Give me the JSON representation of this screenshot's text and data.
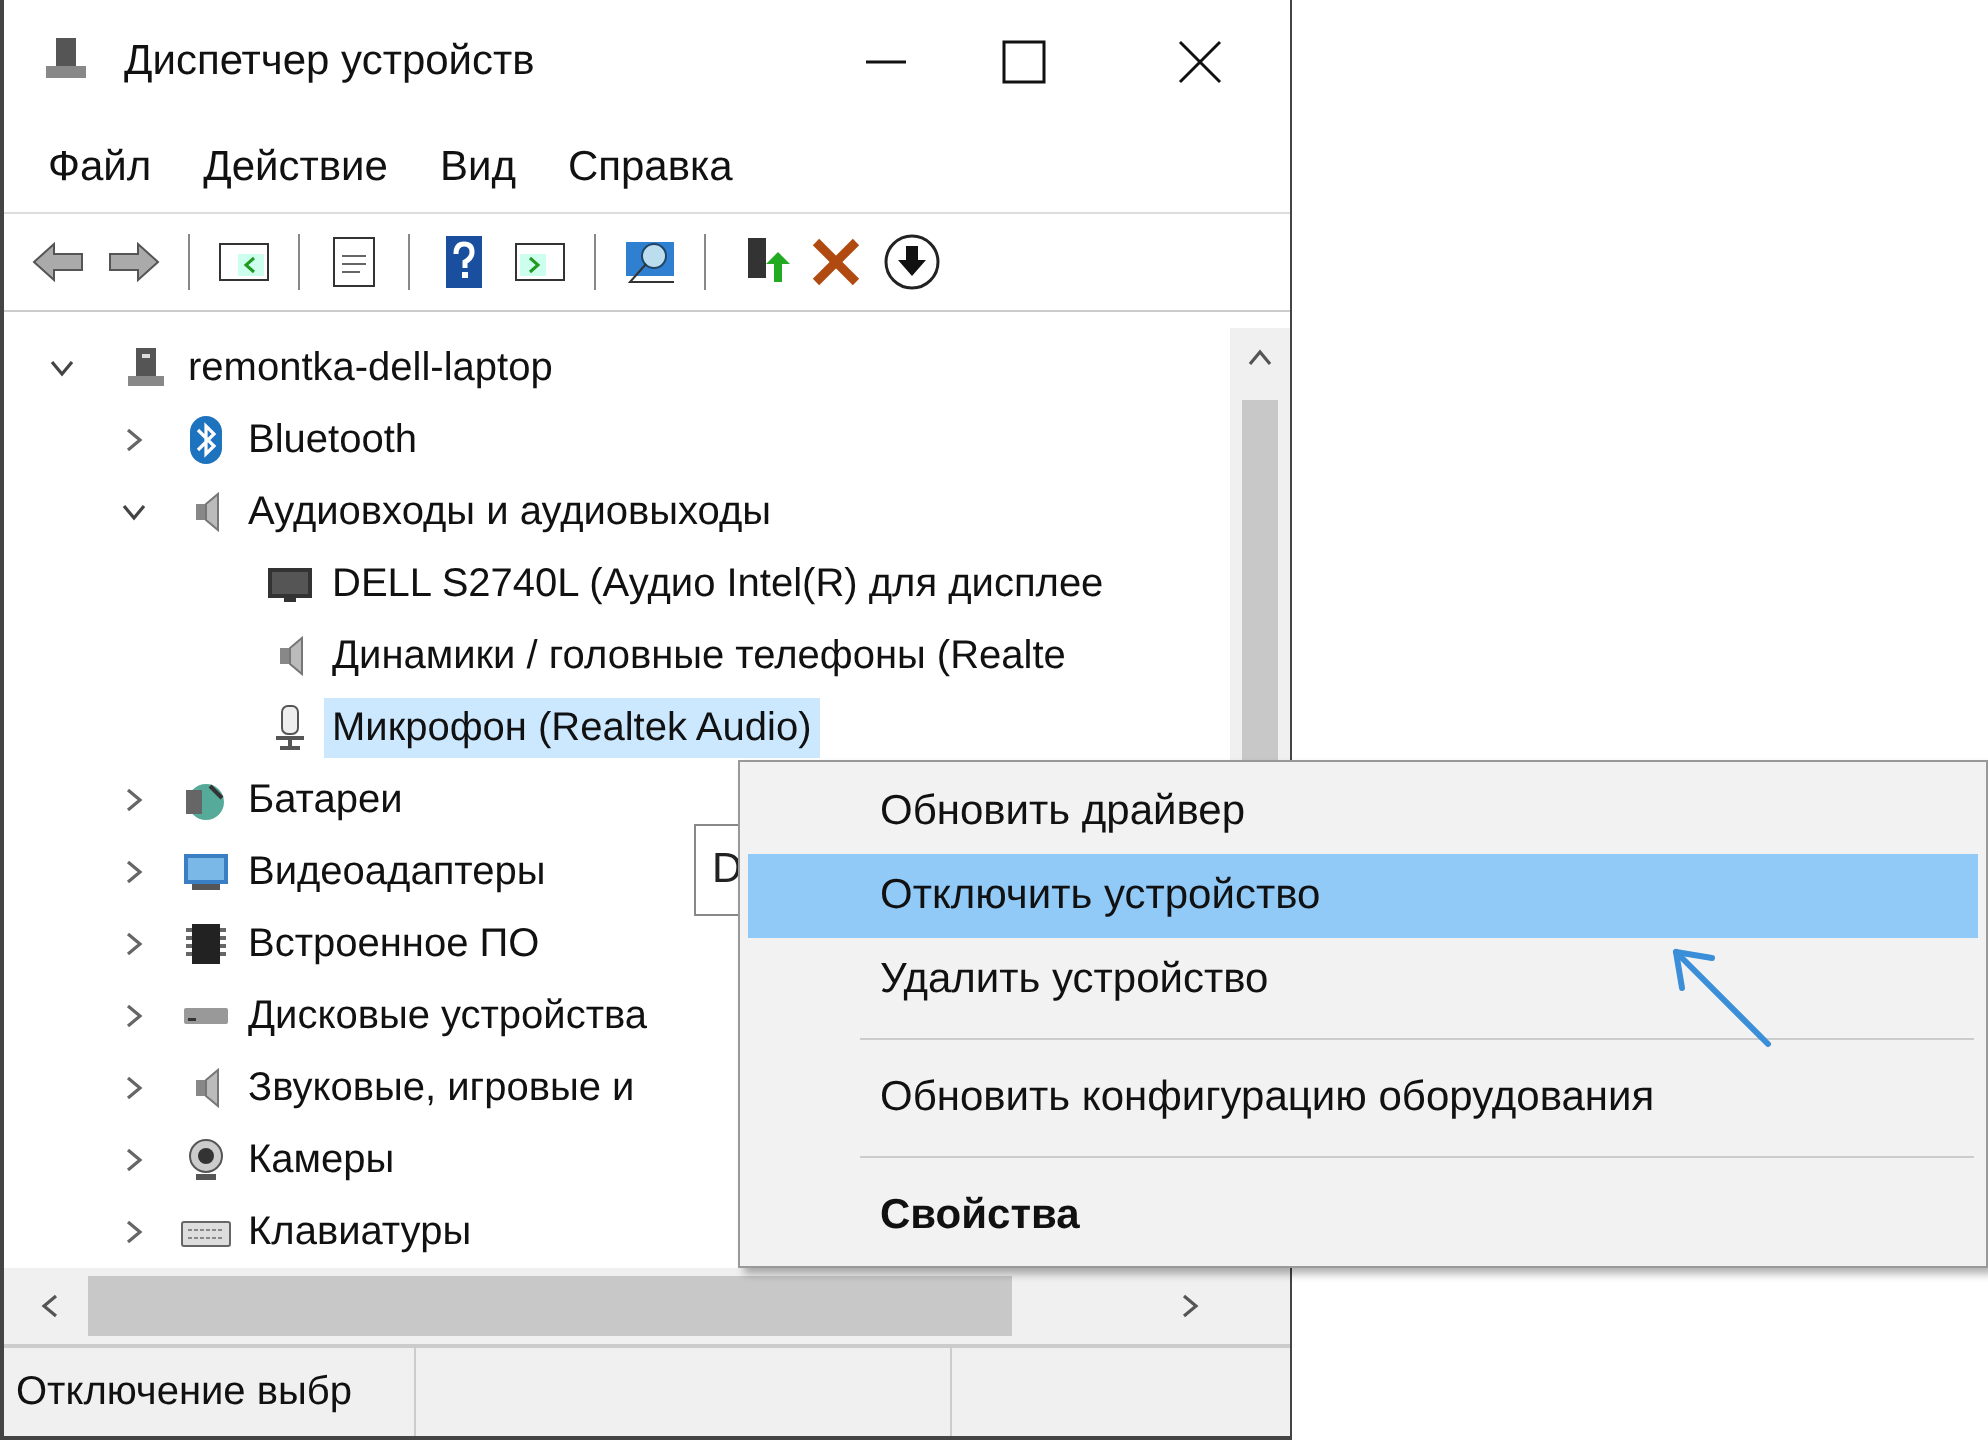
{
  "window": {
    "title": "Диспетчер устройств"
  },
  "menu": [
    "Файл",
    "Действие",
    "Вид",
    "Справка"
  ],
  "tree": {
    "label": "remontka-dell-laptop",
    "expanded": true,
    "selected": false,
    "children": [
      {
        "label": "Bluetooth",
        "expanded": false,
        "selected": false
      },
      {
        "label": "Аудиовходы и аудиовыходы",
        "expanded": true,
        "selected": false,
        "children": [
          {
            "label": "DELL S2740L (Аудио Intel(R) для дисплее",
            "selected": false
          },
          {
            "label": "Динамики / головные телефоны (Realte",
            "selected": false
          },
          {
            "label": "Микрофон (Realtek Audio)",
            "selected": true
          }
        ]
      },
      {
        "label": "Батареи",
        "expanded": false,
        "selected": false
      },
      {
        "label": "Видеоадаптеры",
        "expanded": false,
        "selected": false
      },
      {
        "label": "Встроенное ПО",
        "expanded": false,
        "selected": false
      },
      {
        "label": "Дисковые устройства",
        "expanded": false,
        "selected": false
      },
      {
        "label": "Звуковые, игровые и",
        "expanded": false,
        "selected": false
      },
      {
        "label": "Камеры",
        "expanded": false,
        "selected": false
      },
      {
        "label": "Клавиатуры",
        "expanded": false,
        "selected": false
      }
    ]
  },
  "tooltip": "D",
  "status_bar": "Отключение выбр",
  "context_menu": {
    "sections": [
      [
        {
          "label": "Обновить драйвер",
          "selected": false,
          "default": false
        },
        {
          "label": "Отключить устройство",
          "selected": true,
          "default": false
        },
        {
          "label": "Удалить устройство",
          "selected": false,
          "default": false
        }
      ],
      [
        {
          "label": "Обновить конфигурацию оборудования",
          "selected": false,
          "default": false
        }
      ],
      [
        {
          "label": "Свойства",
          "selected": false,
          "default": true
        }
      ]
    ]
  }
}
